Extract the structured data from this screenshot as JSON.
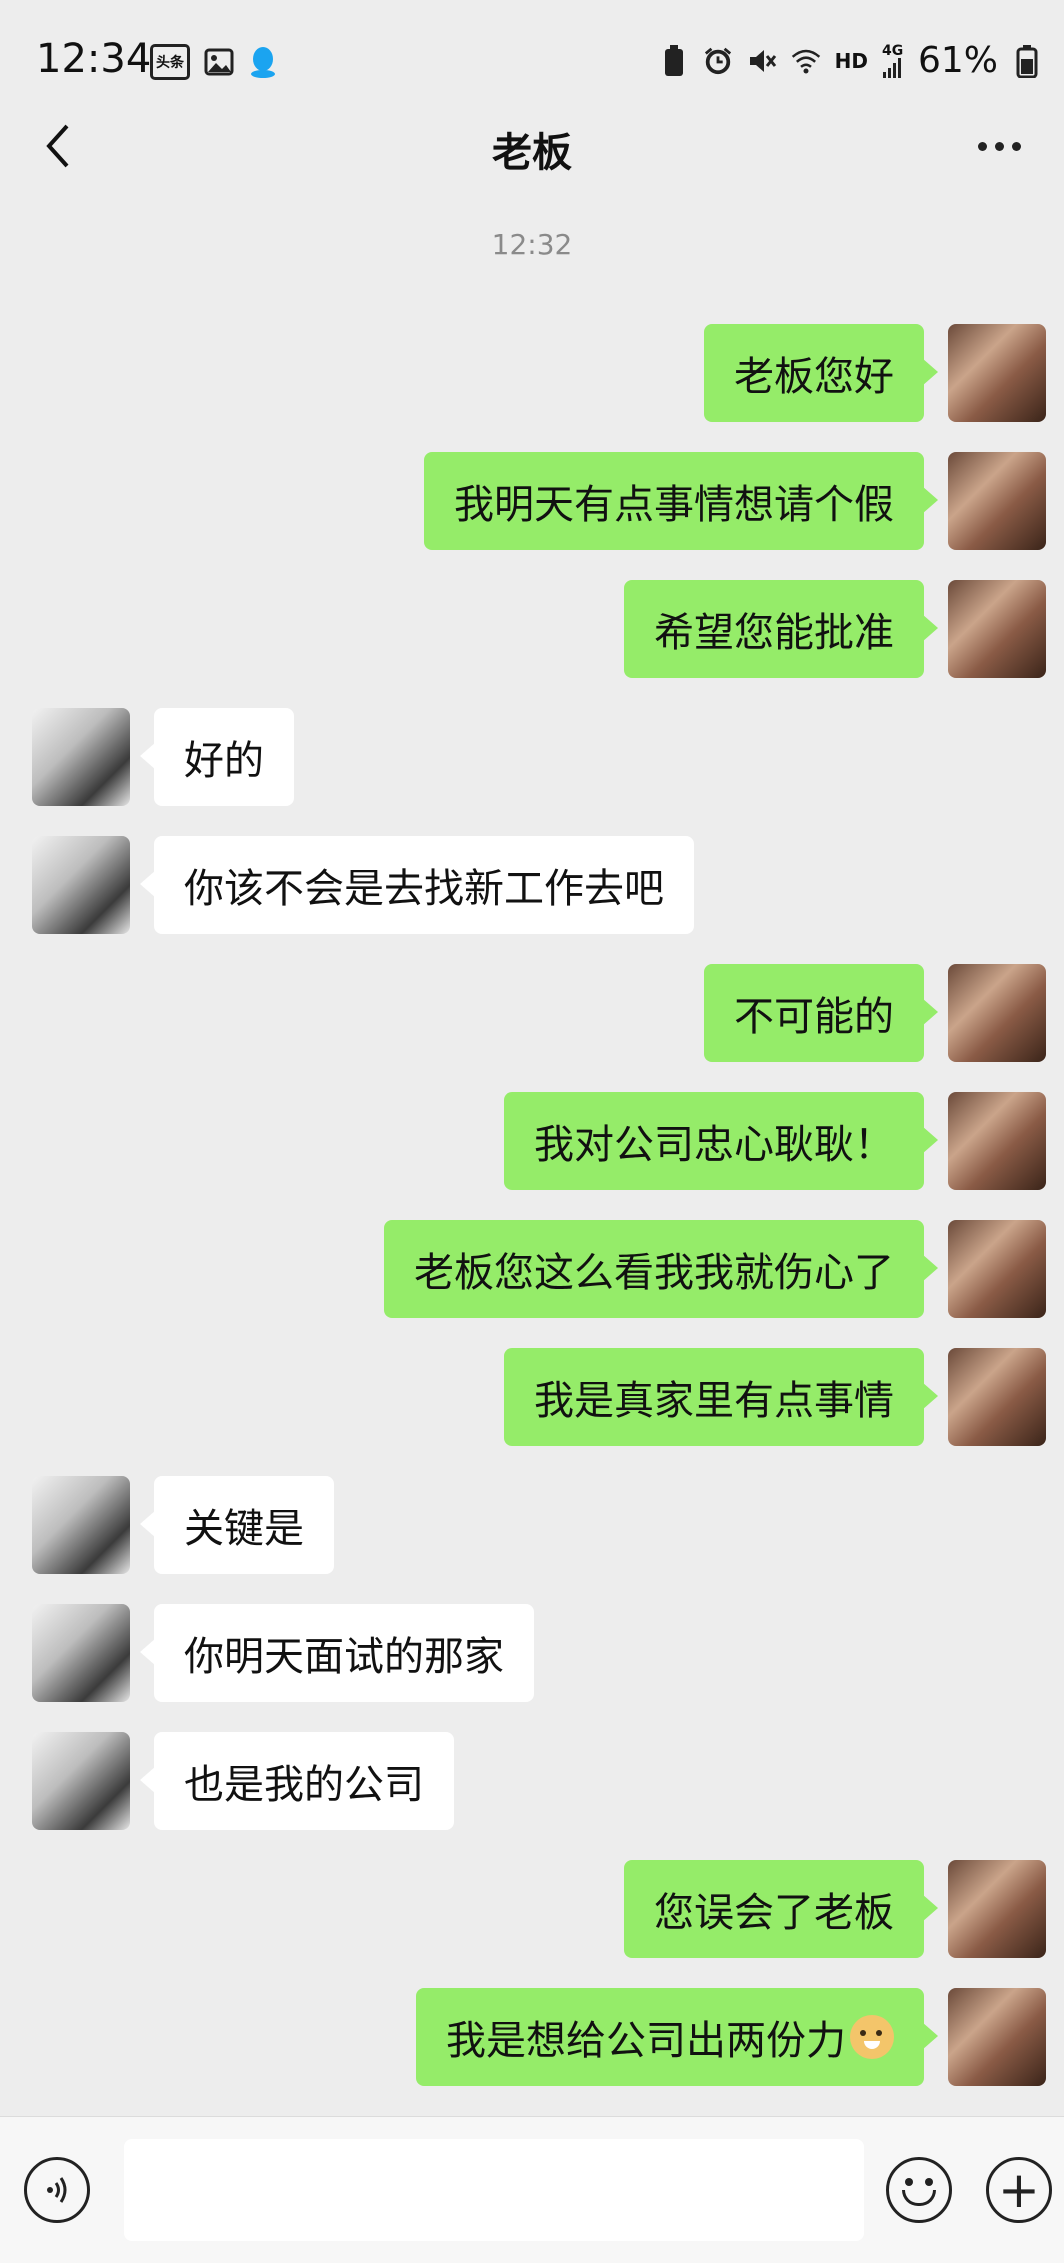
{
  "status_bar": {
    "time": "12:34",
    "toutiao_badge": "头条",
    "network_label": "HD",
    "network_gen": "4G",
    "battery": "61%"
  },
  "header": {
    "title": "老板"
  },
  "timestamp": "12:32",
  "messages": [
    {
      "side": "out",
      "text": "老板您好"
    },
    {
      "side": "out",
      "text": "我明天有点事情想请个假"
    },
    {
      "side": "out",
      "text": "希望您能批准"
    },
    {
      "side": "in",
      "text": "好的"
    },
    {
      "side": "in",
      "text": "你该不会是去找新工作去吧"
    },
    {
      "side": "out",
      "text": "不可能的"
    },
    {
      "side": "out",
      "text": "我对公司忠心耿耿！"
    },
    {
      "side": "out",
      "text": "老板您这么看我我就伤心了"
    },
    {
      "side": "out",
      "text": "我是真家里有点事情"
    },
    {
      "side": "in",
      "text": "关键是"
    },
    {
      "side": "in",
      "text": "你明天面试的那家"
    },
    {
      "side": "in",
      "text": "也是我的公司"
    },
    {
      "side": "out",
      "text": "您误会了老板"
    },
    {
      "side": "out",
      "text": "我是想给公司出两份力",
      "emoji": "doge-emoji"
    }
  ],
  "input_bar": {
    "value": ""
  },
  "colors": {
    "outgoing_bubble": "#95ec69",
    "incoming_bubble": "#ffffff",
    "background": "#ededed"
  }
}
